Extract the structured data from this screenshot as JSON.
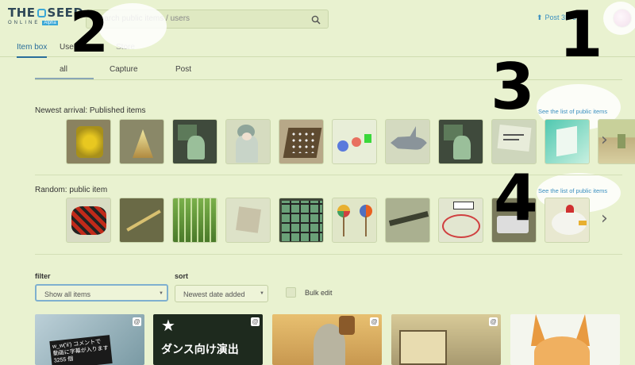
{
  "header": {
    "logo_main": "THE SEED",
    "logo_main_left": "THE",
    "logo_main_right": "SEED",
    "logo_sub": "ONLINE",
    "logo_badge": "Alpha",
    "search_placeholder": "Search public items / users",
    "post_label": "Post 3D o",
    "avatar_icon": "user-avatar"
  },
  "tabs": [
    {
      "label": "Item box",
      "active": true
    },
    {
      "label": "User m",
      "active": false
    },
    {
      "label": "Store",
      "active": false
    }
  ],
  "subtabs": [
    {
      "label": "all",
      "active": true
    },
    {
      "label": "Capture",
      "active": false
    },
    {
      "label": "Post",
      "active": false
    }
  ],
  "annotations": [
    "1",
    "2",
    "3",
    "4"
  ],
  "newest": {
    "title": "Newest arrival: Published items",
    "see_list": "See the list of public items"
  },
  "random": {
    "title": "Random: public item",
    "see_list": "See the list of public items"
  },
  "filter": {
    "label": "filter",
    "value": "Show all items"
  },
  "sort": {
    "label": "sort",
    "value": "Newest date added"
  },
  "bulk_edit": "Bulk edit",
  "cards": [
    {
      "text": "w_w('ii') コメントで 動画に字幕が入ります 3255 個",
      "clip": "@"
    },
    {
      "text": "ダンス向け演出",
      "clip": "@"
    },
    {
      "text": "",
      "clip": "@"
    },
    {
      "text": "",
      "clip": "@"
    },
    {
      "text": "",
      "clip": ""
    }
  ]
}
